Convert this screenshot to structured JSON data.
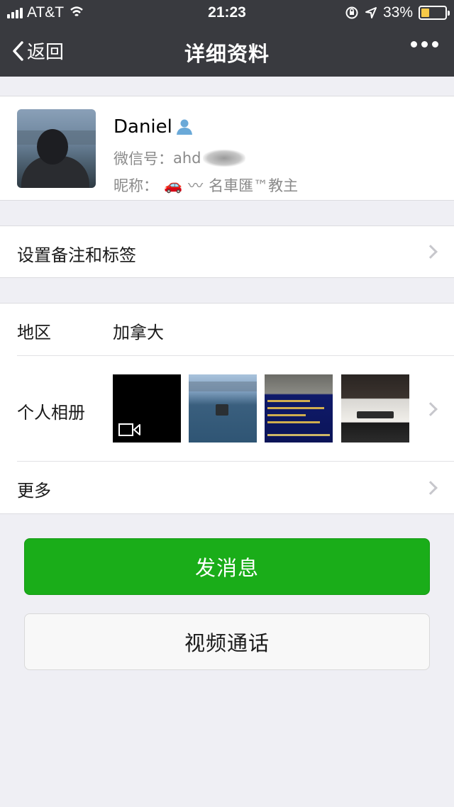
{
  "status_bar": {
    "carrier": "AT&T",
    "time": "21:23",
    "battery_percent": "33%",
    "battery_level": 0.33,
    "battery_color": "#f7c948"
  },
  "nav": {
    "back_label": "返回",
    "title": "详细资料",
    "more_icon": "more-dots-icon"
  },
  "profile": {
    "name": "Daniel",
    "wechat_id_label": "微信号：",
    "wechat_id_value": "ahd",
    "nickname_label": "昵称：",
    "nickname_emoji": "🚗",
    "nickname_tilde": "〰",
    "nickname_text": "名車匯™教主"
  },
  "remark_row": {
    "label": "设置备注和标签"
  },
  "info": {
    "region_label": "地区",
    "region_value": "加拿大",
    "album_label": "个人相册",
    "more_label": "更多"
  },
  "buttons": {
    "send_message": "发消息",
    "video_call": "视频通话"
  },
  "colors": {
    "nav_bg": "#393a3f",
    "primary_green": "#1aad19",
    "page_bg": "#efeff4"
  }
}
